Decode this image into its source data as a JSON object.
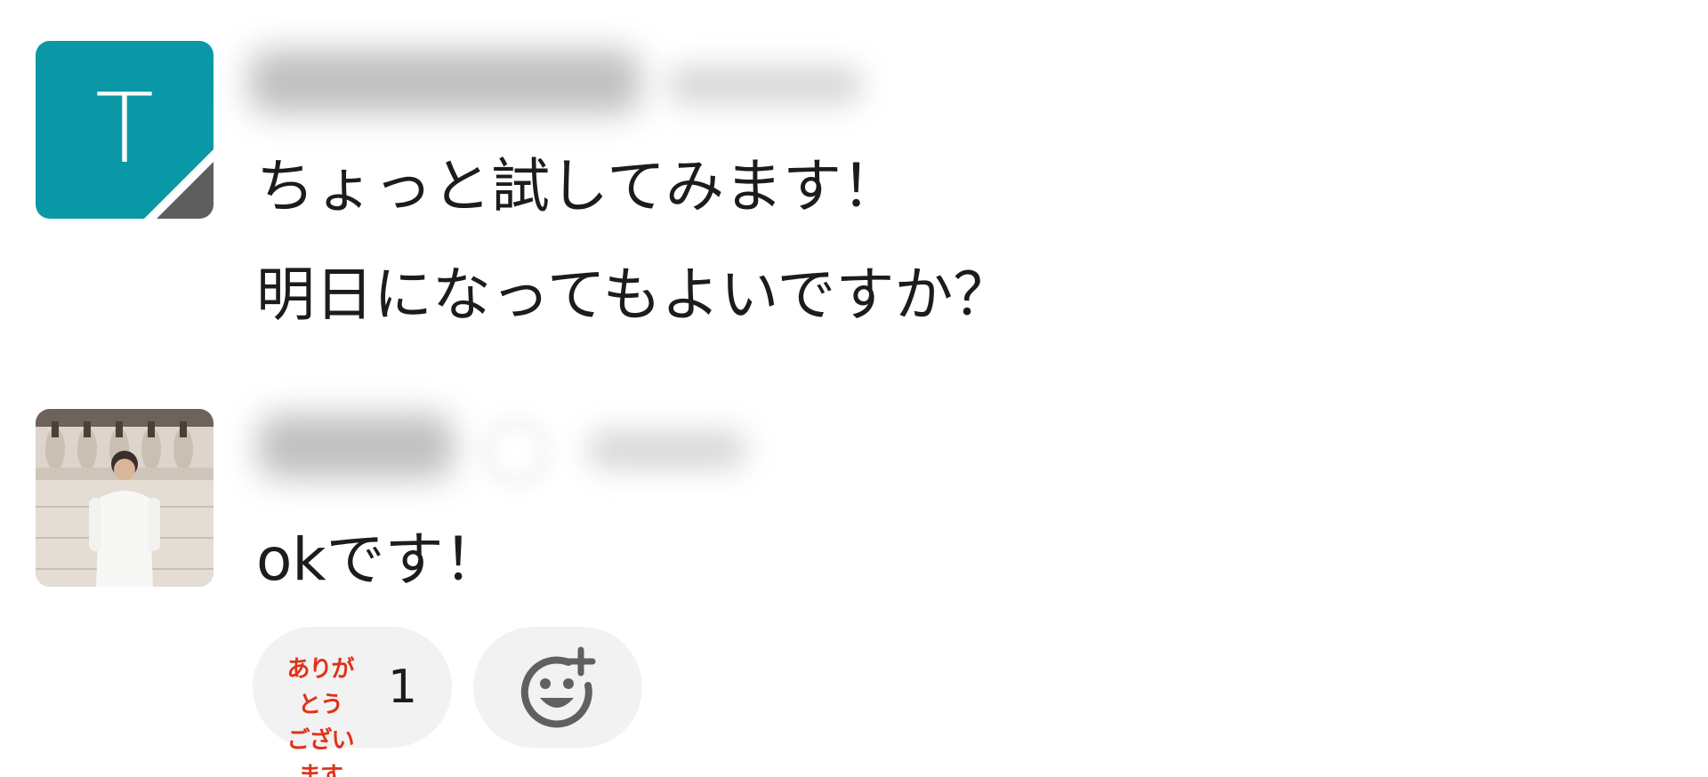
{
  "messages": [
    {
      "avatar_initial": "T",
      "lines": [
        "ちょっと試してみます！",
        "明日になってもよいですか？"
      ]
    },
    {
      "lines": [
        "okです！"
      ],
      "reactions": [
        {
          "emoji_text_line1": "ありがとう",
          "emoji_text_line2": "ございます",
          "count": "1"
        }
      ]
    }
  ],
  "icons": {
    "add_reaction": "add-reaction-smiley-icon"
  },
  "colors": {
    "avatar_teal": "#0b98a6",
    "reaction_text_red": "#e0321a",
    "pill_background": "#f2f2f2"
  }
}
